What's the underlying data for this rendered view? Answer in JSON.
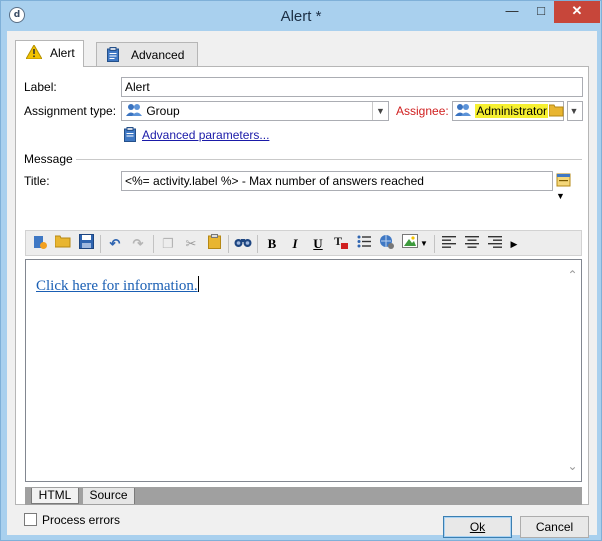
{
  "window": {
    "title": "Alert *"
  },
  "tabs": [
    {
      "label": "Alert",
      "icon": "warning-icon"
    },
    {
      "label": "Advanced",
      "icon": "clipboard-icon"
    }
  ],
  "form": {
    "label_caption": "Label:",
    "label_value": "Alert",
    "assignment_caption": "Assignment type:",
    "assignment_value": "Group",
    "assignee_caption": "Assignee:",
    "assignee_value": "Administrator",
    "advanced_link": "Advanced parameters...",
    "message_section": "Message",
    "title_caption": "Title:",
    "title_value": "<%= activity.label %> - Max number of answers reached"
  },
  "editor": {
    "content_link": "Click here for information.",
    "mode_tabs": [
      "HTML",
      "Source"
    ],
    "active_mode": "HTML"
  },
  "footer": {
    "process_errors_label": "Process errors",
    "process_errors_checked": false,
    "ok_label": "Ok",
    "cancel_label": "Cancel"
  },
  "colors": {
    "assignee_label": "#d02020",
    "highlight": "#f6f030",
    "link": "#1a1aa8"
  }
}
